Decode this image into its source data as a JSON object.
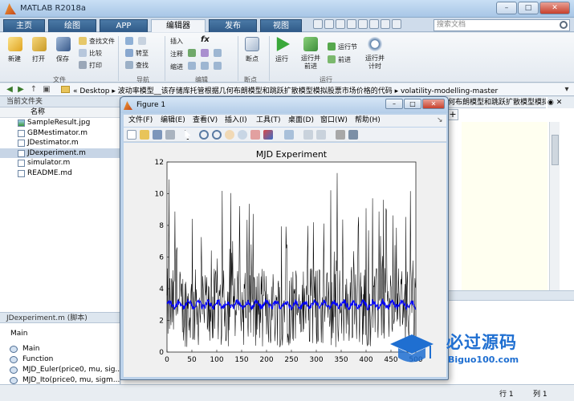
{
  "window": {
    "title": "MATLAB R2018a",
    "controls": [
      "–",
      "□",
      "✕"
    ]
  },
  "ribbon_tabs": [
    "主页",
    "绘图",
    "APP",
    "编辑器",
    "发布",
    "视图"
  ],
  "active_tab": "编辑器",
  "search": {
    "placeholder": "搜索文档"
  },
  "ribbon": {
    "new": "新建",
    "open": "打开",
    "save": "保存",
    "find_files": "查找文件",
    "compare": "比较",
    "print": "打印",
    "goto": "转至",
    "find": "查找",
    "insert": "插入",
    "fx": "fx",
    "comment": "注释",
    "indent": "缩进",
    "breakpoints": "断点",
    "run": "运行",
    "run_advance": "运行并\n前进",
    "run_section": "运行节",
    "advance": "前进",
    "run_time": "运行并\n计时",
    "groups": {
      "file": "文件",
      "navigate": "导航",
      "edit": "编辑",
      "breakpoints": "断点",
      "run": "运行"
    }
  },
  "address": {
    "path": "«  Desktop  ▸  波动率模型__该存储库托管根据几何布朗模型和跳跃扩散模型模拟股票市场价格的代码  ▸  volatility-modelling-master"
  },
  "current_folder": {
    "header": "当前文件夹",
    "column": "名称",
    "files": [
      {
        "name": "SampleResult.jpg",
        "type": "img"
      },
      {
        "name": "GBMestimator.m",
        "type": "m"
      },
      {
        "name": "JDestimator.m",
        "type": "m"
      },
      {
        "name": "JDexperiment.m",
        "type": "m",
        "selected": true
      },
      {
        "name": "simulator.m",
        "type": "m"
      },
      {
        "name": "README.md",
        "type": "md"
      }
    ]
  },
  "details": {
    "header": "JDexperiment.m  (脚本)",
    "section": "Main",
    "functions": [
      "Main",
      "Function",
      "MJD_Euler(price0, mu, sig...",
      "MJD_Ito(price0, mu, sigm..."
    ]
  },
  "editor": {
    "tab_title": "何布朗模型和跳跃扩散模型模拟股票",
    "controls": "◉ ✕"
  },
  "status": {
    "row": "行 1",
    "col": "列 1"
  },
  "figure": {
    "title": "Figure 1",
    "menu": [
      "文件(F)",
      "编辑(E)",
      "查看(V)",
      "插入(I)",
      "工具(T)",
      "桌面(D)",
      "窗口(W)",
      "帮助(H)"
    ]
  },
  "chart_data": {
    "type": "line",
    "title": "MJD Experiment",
    "xlabel": "",
    "ylabel": "",
    "xlim": [
      0,
      500
    ],
    "ylim": [
      0,
      12
    ],
    "xticks": [
      0,
      50,
      100,
      150,
      200,
      250,
      300,
      350,
      400,
      450,
      500
    ],
    "yticks": [
      0,
      2,
      4,
      6,
      8,
      10,
      12
    ],
    "xtick_labels": [
      "0",
      "50",
      "100",
      "150",
      "200",
      "250",
      "300",
      "350",
      "400",
      "450",
      "500"
    ],
    "ytick_labels": [
      "0",
      "2",
      "4",
      "6",
      "8",
      "10",
      "12"
    ],
    "series": [
      {
        "color": "#000000",
        "description": "volatile series oscillating between ~0 and ~11",
        "baseline": 2.8,
        "amplitude": 2.5,
        "peak_max": 11.3
      },
      {
        "color": "#0000ff",
        "description": "smooth series around ~3",
        "level": 3.0,
        "amplitude": 0.35
      }
    ],
    "grid": false
  },
  "watermark": {
    "cn": "必过源码",
    "en": "Biguo100.com"
  }
}
